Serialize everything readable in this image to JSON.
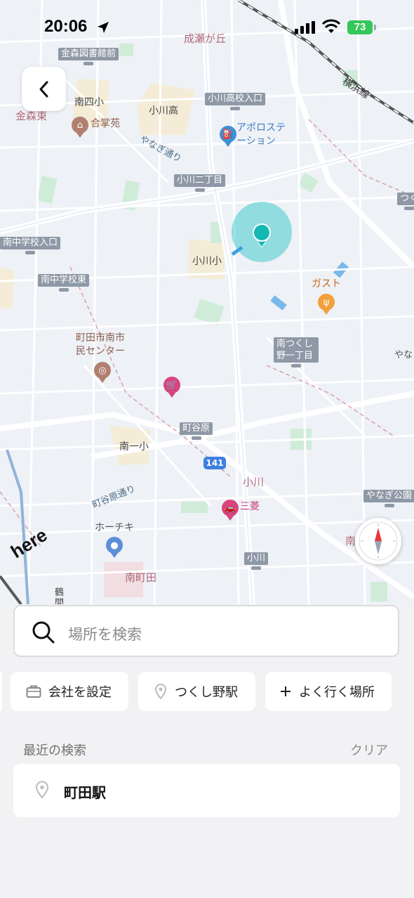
{
  "status_bar": {
    "time": "20:06",
    "battery": "73"
  },
  "map": {
    "labels": {
      "naruse": "成瀬が丘",
      "kanamori_lib": "金森図書館前",
      "minami4": "南四小",
      "kanamori_east": "金森東",
      "gougakuen": "合掌苑",
      "ogawa_high": "小川高",
      "ogawa_high_entrance": "小川高校入口",
      "yokohama_line": "横浜線",
      "apollo": "アポロステーション",
      "yanagi_st": "やなぎ通り",
      "ogawa2": "小川二丁目",
      "tsuku": "つく",
      "minami_jh_entrance": "南中学校入口",
      "ogawa_elem": "小川小",
      "minami_jh_east": "南中学校東",
      "gusto": "ガスト",
      "machida_center": "町田市南市民センター",
      "minami_tsukushino": "南つくし野一丁目",
      "yana": "やな",
      "machiyahara": "町谷原",
      "minami1": "南一小",
      "route141": "141",
      "ogawa_district": "小川",
      "machiyahara_st": "町谷原通り",
      "mitsubishi": "三菱",
      "yanagi_park": "やなぎ公園",
      "hochiki": "ホーチキ",
      "ogawa_stop": "小川",
      "minami_machida": "南町田",
      "minami": "南",
      "tsuru": "鶴間"
    },
    "here_logo": "here"
  },
  "panel": {
    "search_placeholder": "場所を検索",
    "chips": [
      {
        "label": "会社を設定",
        "icon": "briefcase-icon"
      },
      {
        "label": "つくし野駅",
        "icon": "pin-icon"
      },
      {
        "label": "よく行く場所",
        "icon": "plus-icon"
      }
    ],
    "recent_title": "最近の検索",
    "clear_label": "クリア",
    "recent_items": [
      {
        "label": "町田駅",
        "icon": "pin-icon"
      }
    ]
  },
  "colors": {
    "accent": "#1ec4c4",
    "map_bg": "#eef1f6",
    "battery": "#34c759"
  }
}
